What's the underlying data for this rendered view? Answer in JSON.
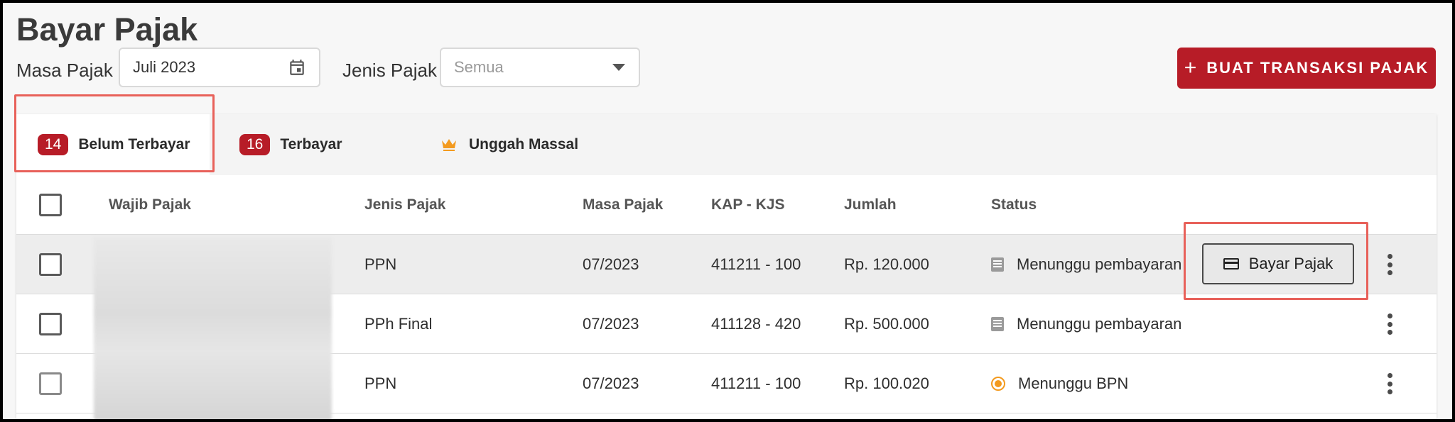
{
  "page": {
    "title": "Bayar Pajak"
  },
  "filters": {
    "masa_label": "Masa Pajak",
    "masa_value": "Juli 2023",
    "jenis_label": "Jenis Pajak",
    "jenis_placeholder": "Semua"
  },
  "create_button": {
    "icon": "plus-icon",
    "label": "BUAT TRANSAKSI PAJAK"
  },
  "tabs": [
    {
      "count": "14",
      "label": "Belum Terbayar",
      "active": true
    },
    {
      "count": "16",
      "label": "Terbayar",
      "active": false
    },
    {
      "icon": "crown-icon",
      "label": "Unggah Massal",
      "active": false
    }
  ],
  "table": {
    "headers": [
      "Wajib Pajak",
      "Jenis Pajak",
      "Masa Pajak",
      "KAP - KJS",
      "Jumlah",
      "Status"
    ],
    "rows": [
      {
        "jenis": "PPN",
        "masa": "07/2023",
        "kap": "411211 - 100",
        "jumlah": "Rp. 120.000",
        "status": "Menunggu pembayaran",
        "status_icon": "document-icon",
        "action": "Bayar Pajak"
      },
      {
        "jenis": "PPh Final",
        "masa": "07/2023",
        "kap": "411128 - 420",
        "jumlah": "Rp. 500.000",
        "status": "Menunggu pembayaran",
        "status_icon": "document-icon"
      },
      {
        "jenis": "PPN",
        "masa": "07/2023",
        "kap": "411211 - 100",
        "jumlah": "Rp. 100.020",
        "status": "Menunggu BPN",
        "status_icon": "pending-clock-icon"
      }
    ]
  },
  "colors": {
    "brand": "#b71c27",
    "highlight": "#e8615a",
    "pending": "#f39a1e"
  }
}
